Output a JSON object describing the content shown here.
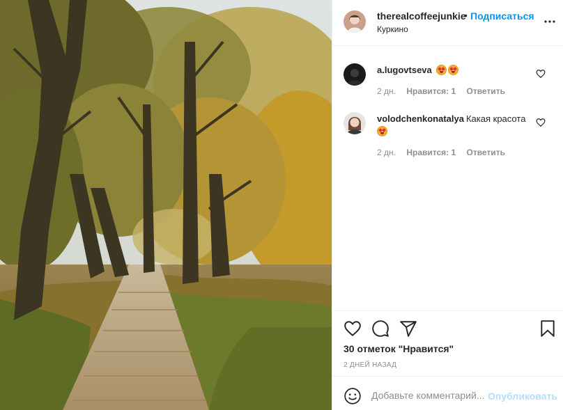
{
  "post": {
    "image_alt": "autumn park path with trees",
    "header": {
      "username": "therealcoffeejunkie",
      "separator": "•",
      "follow_label": "Подписаться",
      "location": "Куркино",
      "more_icon": "more-horizontal-icon"
    },
    "comments": [
      {
        "username": "a.lugovtseva",
        "text": "",
        "emoji_count": 2,
        "time": "2 дн.",
        "likes": "Нравится: 1",
        "reply": "Ответить",
        "like_icon": "heart-outline-icon"
      },
      {
        "username": "volodchenkonatalya",
        "text": "Какая красота",
        "emoji_count": 1,
        "time": "2 дн.",
        "likes": "Нравится: 1",
        "reply": "Ответить",
        "like_icon": "heart-outline-icon"
      }
    ],
    "actions": {
      "icons": [
        "heart-icon",
        "comment-icon",
        "share-icon",
        "bookmark-icon"
      ],
      "likes_text": "30 отметок \"Нравится\"",
      "date": "2 ДНЕЙ НАЗАД"
    },
    "add_comment": {
      "placeholder": "Добавьте комментарий...",
      "publish_label": "Опубликовать",
      "emoji_icon": "smile-icon"
    }
  },
  "colors": {
    "link_blue": "#0095f6",
    "publish_disabled": "#b2dffc",
    "muted": "#8e8e8e",
    "text": "#262626",
    "border": "#efefef"
  }
}
